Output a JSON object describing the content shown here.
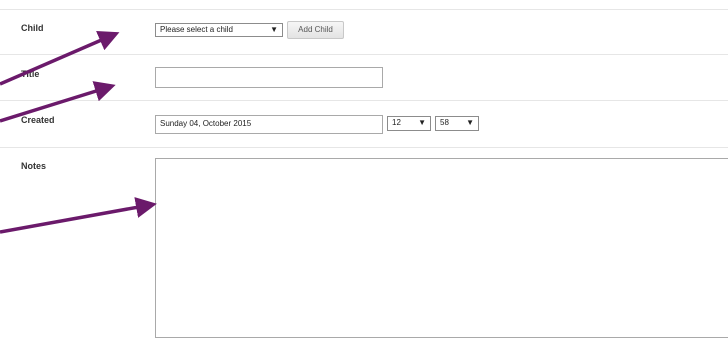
{
  "form": {
    "child": {
      "label": "Child",
      "select_value": "Please select a child",
      "add_button_label": "Add Child"
    },
    "title": {
      "label": "Title",
      "value": ""
    },
    "created": {
      "label": "Created",
      "date_value": "Sunday 04, October 2015",
      "hour_value": "12",
      "minute_value": "58"
    },
    "notes": {
      "label": "Notes",
      "value": ""
    }
  },
  "icons": {
    "dropdown": "▼"
  },
  "colors": {
    "annotation_arrow": "#6b1a6b"
  }
}
